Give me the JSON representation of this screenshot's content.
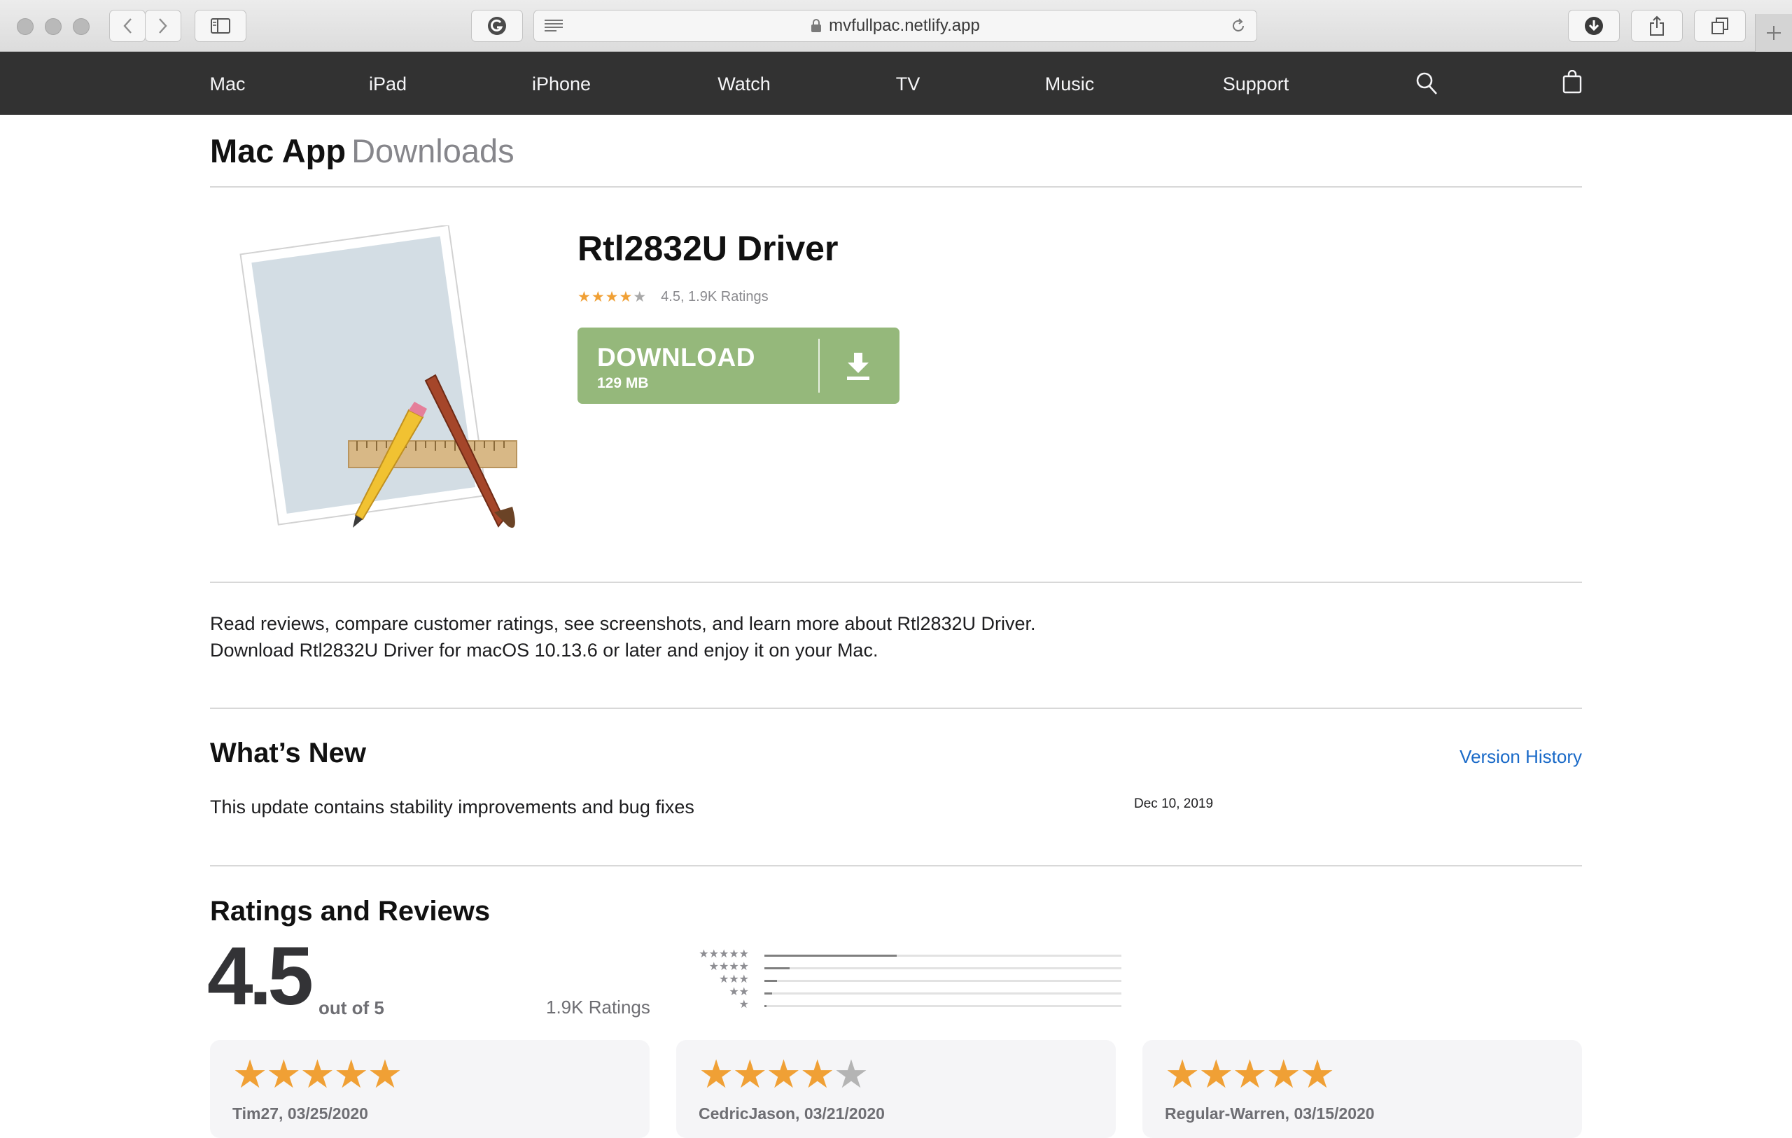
{
  "browser": {
    "url": "mvfullpac.netlify.app"
  },
  "nav": {
    "items": [
      "Mac",
      "iPad",
      "iPhone",
      "Watch",
      "TV",
      "Music",
      "Support"
    ]
  },
  "page": {
    "title_bold": "Mac App",
    "title_light": "Downloads"
  },
  "app": {
    "name": "Rtl2832U Driver",
    "rating_text": "4.5, 1.9K Ratings",
    "rating_value": 4.5,
    "download_label": "DOWNLOAD",
    "download_size": "129 MB"
  },
  "description": {
    "line1": "Read reviews, compare customer ratings, see screenshots, and learn more about Rtl2832U Driver.",
    "line2": "Download Rtl2832U Driver for macOS 10.13.6 or later and enjoy it on your Mac."
  },
  "whats_new": {
    "title": "What’s New",
    "version_history_link": "Version History",
    "text": "This update contains stability improvements and bug fixes",
    "date": "Dec 10, 2019"
  },
  "ratings": {
    "title": "Ratings and Reviews",
    "score": "4.5",
    "out_of": "out of 5",
    "count": "1.9K Ratings",
    "histogram": [
      {
        "stars": 5,
        "fraction": 0.37
      },
      {
        "stars": 4,
        "fraction": 0.07
      },
      {
        "stars": 3,
        "fraction": 0.035
      },
      {
        "stars": 2,
        "fraction": 0.022
      },
      {
        "stars": 1,
        "fraction": 0.005
      }
    ]
  },
  "reviews": [
    {
      "stars": 5,
      "author": "Tim27, 03/25/2020"
    },
    {
      "stars": 4,
      "author": "CedricJason, 03/21/2020"
    },
    {
      "stars": 5,
      "author": "Regular-Warren, 03/15/2020"
    }
  ],
  "colors": {
    "nav_bg": "#323232",
    "download_green": "#95b87b",
    "star_orange": "#f0a035",
    "link_blue": "#1a6ac8"
  }
}
